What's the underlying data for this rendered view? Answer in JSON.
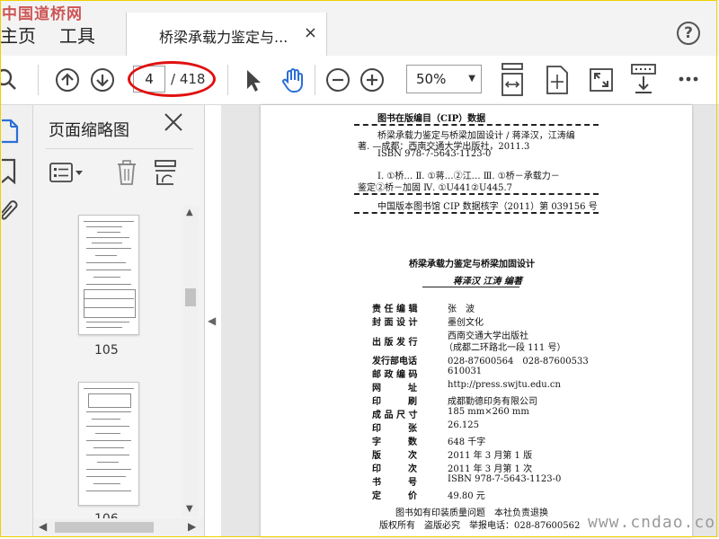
{
  "watermark_top": "中国道桥网",
  "watermark_bottom": "www.cndao.co",
  "menu": {
    "home": "主页",
    "tools": "工具"
  },
  "tab": {
    "title": "桥梁承载力鉴定与...",
    "close": "×"
  },
  "help": "?",
  "toolbar": {
    "current_page": "4",
    "total_pages": "/ 418",
    "zoom": "50%"
  },
  "panel": {
    "title": "页面缩略图",
    "thumbs": [
      {
        "label": "105"
      },
      {
        "label": "106"
      }
    ]
  },
  "doc": {
    "cip_header": "图书在版编目（CIP）数据",
    "cip_line1": "桥梁承载力鉴定与桥梁加固设计 / 蒋泽汉，江涛编",
    "cip_line2": "著. —成都：西南交通大学出版社，2011.3",
    "cip_line3": "ISBN 978-7-5643-1123-0",
    "cip_line4": "Ⅰ. ①桥…  Ⅱ. ①蒋…②江…  Ⅲ. ①桥－承载力－",
    "cip_line5": "鉴定②桥－加固  Ⅳ. ①U441②U445.7",
    "cip_number": "中国版本图书馆 CIP 数据核字（2011）第 039156 号",
    "book_title": "桥梁承载力鉴定与桥梁加固设计",
    "book_authors": "蒋泽汉   江涛   编著",
    "rows": [
      {
        "label": "责 任 编 辑",
        "value": "张　波"
      },
      {
        "label": "封 面 设 计",
        "value": "墨创文化"
      },
      {
        "label": "出 版 发 行",
        "value": "西南交通大学出版社",
        "value2": "（成都二环路北一段 111 号）"
      },
      {
        "label": "发行部电话",
        "value": "028-87600564　028-87600533"
      },
      {
        "label": "邮 政 编 码",
        "value": "610031"
      },
      {
        "label": "网　　　址",
        "value": "http://press.swjtu.edu.cn"
      },
      {
        "label": "印　　　刷",
        "value": "成都勤德印务有限公司"
      },
      {
        "label": "成 品 尺 寸",
        "value": "185 mm×260 mm"
      },
      {
        "label": "印　　　张",
        "value": "26.125"
      },
      {
        "label": "字　　　数",
        "value": "648 千字"
      },
      {
        "label": "版　　　次",
        "value": "2011 年 3 月第 1 版"
      },
      {
        "label": "印　　　次",
        "value": "2011 年 3 月第 1 次"
      },
      {
        "label": "书　　　号",
        "value": "ISBN 978-7-5643-1123-0"
      },
      {
        "label": "定　　　价",
        "value": "49.80 元"
      }
    ],
    "footer1": "图书如有印装质量问题　本社负责退换",
    "footer2": "版权所有　盗版必究　举报电话：028-87600562"
  }
}
